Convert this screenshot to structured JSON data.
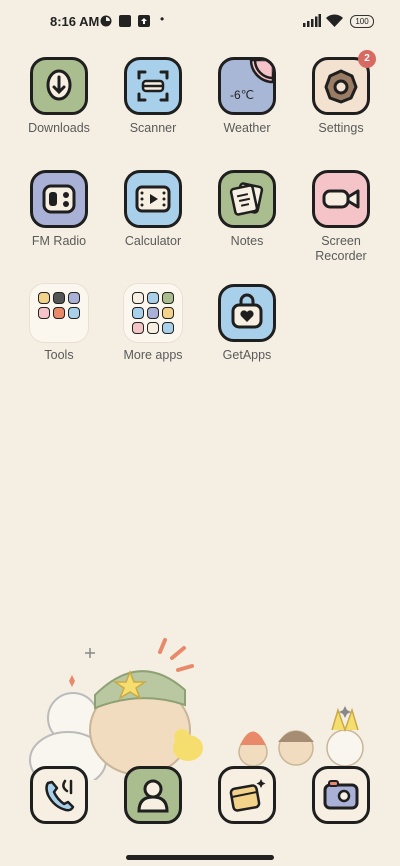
{
  "status_bar": {
    "time": "8:16 AM",
    "battery": "100",
    "dot": "•"
  },
  "apps": [
    {
      "name": "Downloads",
      "color": "#a9bd8e"
    },
    {
      "name": "Scanner",
      "color": "#a8d0ea"
    },
    {
      "name": "Weather",
      "color": "#a9b7d6",
      "temperature": "-6℃"
    },
    {
      "name": "Settings",
      "color": "#f2e2cf",
      "badge": "2"
    },
    {
      "name": "FM Radio",
      "color": "#a9b1d6"
    },
    {
      "name": "Calculator",
      "color": "#a8d0ea"
    },
    {
      "name": "Notes",
      "color": "#a9bd8e"
    },
    {
      "name": "Screen Recorder",
      "color": "#f5c4c8"
    },
    {
      "name": "Tools"
    },
    {
      "name": "More apps"
    },
    {
      "name": "GetApps",
      "color": "#a8d0ea"
    }
  ],
  "dock": [
    {
      "name": "Phone",
      "color": "#f7efe2"
    },
    {
      "name": "Contacts",
      "color": "#a9bd8e"
    },
    {
      "name": "Gallery",
      "color": "#f7efe2"
    },
    {
      "name": "Camera",
      "color": "#f7efe2"
    }
  ]
}
